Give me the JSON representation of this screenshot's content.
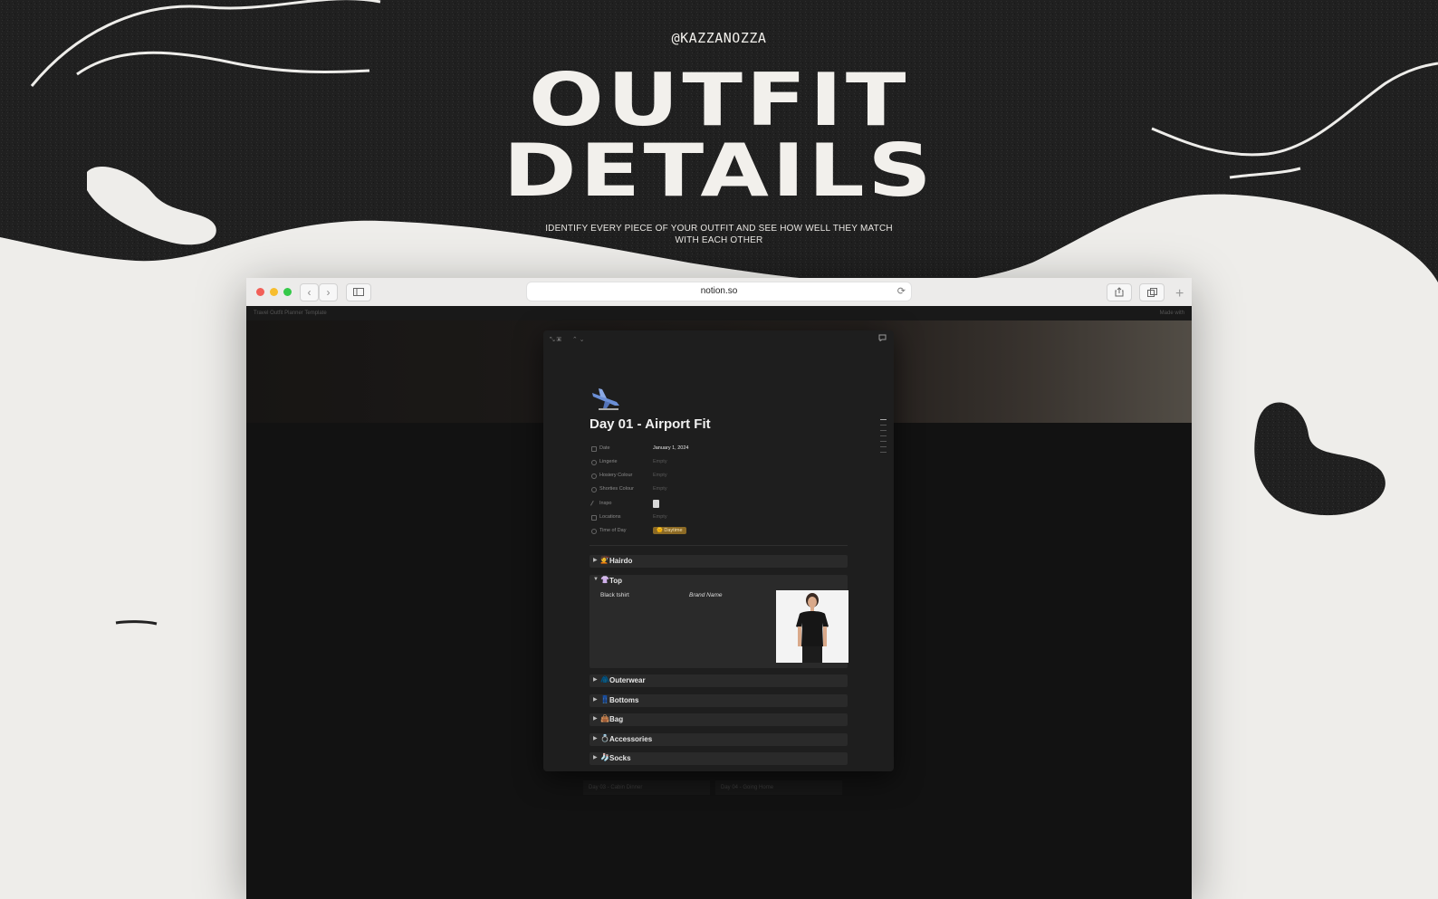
{
  "hero": {
    "handle": "@KAZZANOZZA",
    "headline_line1": "OUTFIT",
    "headline_line2": "DETAILS",
    "subtitle": "IDENTIFY EVERY PIECE OF YOUR OUTFIT AND SEE HOW WELL THEY MATCH WITH EACH OTHER"
  },
  "browser": {
    "url": "notion.so",
    "back_label": "‹",
    "forward_label": "›"
  },
  "notion": {
    "breadcrumb": "Travel Outfit Planner Template",
    "made_with": "Made with",
    "background_cards": [
      "Day 03 - Cabin Dinner",
      "Day 04 - Going Home"
    ]
  },
  "page": {
    "title": "Day 01 - Airport Fit",
    "properties": [
      {
        "name": "Date",
        "value": "January 1, 2024"
      },
      {
        "name": "Lingerie",
        "value": "Empty"
      },
      {
        "name": "Hosiery Colour",
        "value": "Empty"
      },
      {
        "name": "Shorties Colour",
        "value": "Empty"
      },
      {
        "name": "Inspo",
        "value": ""
      },
      {
        "name": "Locations",
        "value": "Empty"
      },
      {
        "name": "Time of Day",
        "value": "Daytime"
      }
    ],
    "time_tag_emoji": "🌞",
    "toggles": [
      {
        "label": "Hairdo",
        "emoji": "💇",
        "arrow": "▶"
      },
      {
        "label": "Top",
        "emoji": "👚",
        "arrow": "▼"
      },
      {
        "label": "Outerwear",
        "emoji": "🧥",
        "arrow": "▶"
      },
      {
        "label": "Bottoms",
        "emoji": "👖",
        "arrow": "▶"
      },
      {
        "label": "Bag",
        "emoji": "👜",
        "arrow": "▶"
      },
      {
        "label": "Accessories",
        "emoji": "💍",
        "arrow": "▶"
      },
      {
        "label": "Socks",
        "emoji": "🧦",
        "arrow": "▶"
      }
    ],
    "top_item": {
      "name": "Black tshirt",
      "brand": "Brand Name"
    }
  },
  "colors": {
    "dark_bg": "#1c1c1c",
    "light_bg": "#eeedea",
    "tag_bg": "#8c6a25"
  }
}
